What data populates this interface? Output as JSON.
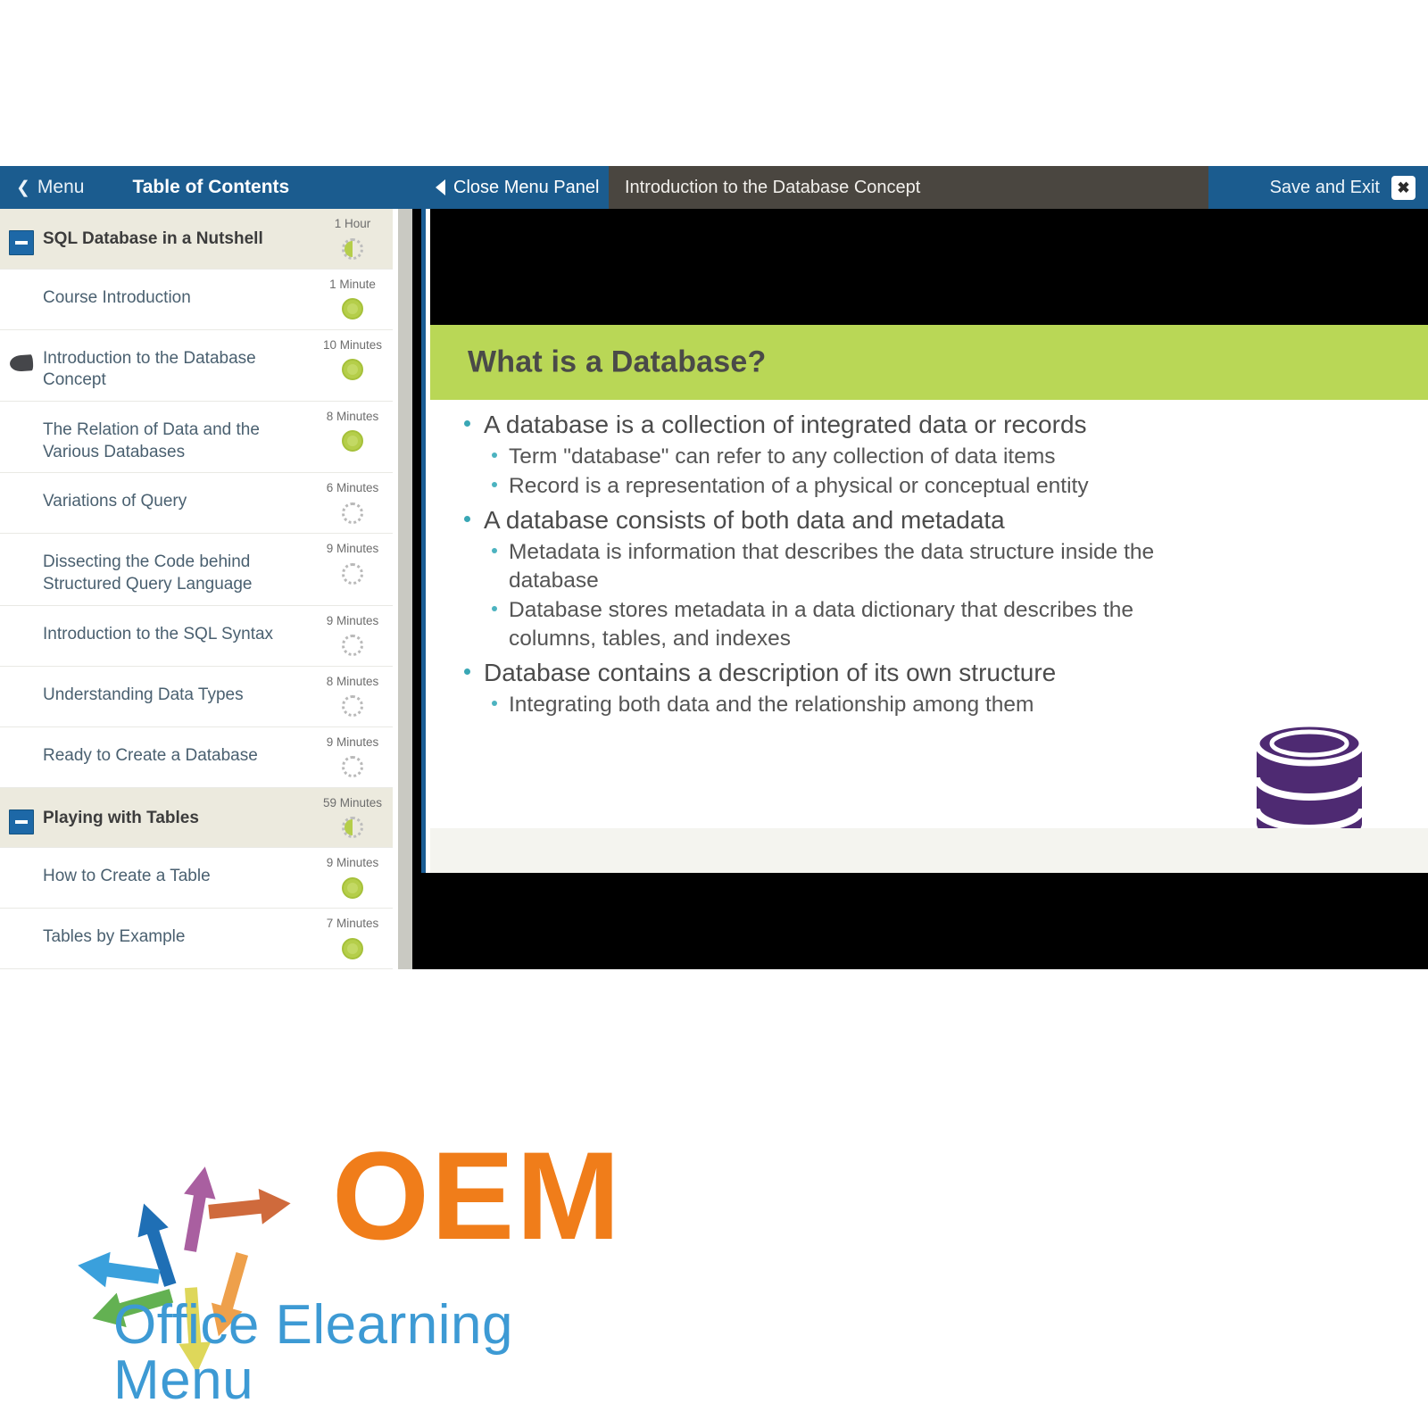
{
  "header": {
    "menu_label": "Menu",
    "toc_label": "Table of Contents",
    "close_panel_label": "Close Menu Panel",
    "current_topic": "Introduction to the Database Concept",
    "save_exit_label": "Save and Exit",
    "close_icon_glyph": "✖",
    "colors": {
      "bar_blue": "#1b5c8f",
      "title_gray": "#4a4640",
      "accent_green": "#b9d756"
    }
  },
  "sidebar": {
    "rows": [
      {
        "type": "section",
        "title": "SQL Database in a Nutshell",
        "duration": "1 Hour",
        "status": "part",
        "current": false
      },
      {
        "type": "item",
        "title": "Course Introduction",
        "duration": "1 Minute",
        "status": "done",
        "current": false
      },
      {
        "type": "item",
        "title": "Introduction to the Database Concept",
        "duration": "10 Minutes",
        "status": "done",
        "current": true
      },
      {
        "type": "item",
        "title": "The Relation of Data and the Various Databases",
        "duration": "8 Minutes",
        "status": "done",
        "current": false
      },
      {
        "type": "item",
        "title": "Variations of Query",
        "duration": "6 Minutes",
        "status": "todo",
        "current": false
      },
      {
        "type": "item",
        "title": "Dissecting the Code behind Structured Query Language",
        "duration": "9 Minutes",
        "status": "todo",
        "current": false
      },
      {
        "type": "item",
        "title": "Introduction to the SQL Syntax",
        "duration": "9 Minutes",
        "status": "todo",
        "current": false
      },
      {
        "type": "item",
        "title": "Understanding Data Types",
        "duration": "8 Minutes",
        "status": "todo",
        "current": false
      },
      {
        "type": "item",
        "title": "Ready to Create a Database",
        "duration": "9 Minutes",
        "status": "todo",
        "current": false
      },
      {
        "type": "section",
        "title": "Playing with Tables",
        "duration": "59 Minutes",
        "status": "part",
        "current": false
      },
      {
        "type": "item",
        "title": "How to Create a Table",
        "duration": "9 Minutes",
        "status": "done",
        "current": false
      },
      {
        "type": "item",
        "title": "Tables by Example",
        "duration": "7 Minutes",
        "status": "done",
        "current": false
      }
    ],
    "scrollbar": {
      "thumb_top_pct": 0,
      "thumb_height_pct": 59
    }
  },
  "slide": {
    "title": "What is a Database?",
    "bullets": [
      {
        "text": "A database is a collection of integrated data or records",
        "children": [
          "Term \"database\" can refer to any collection of data items",
          "Record is a representation of a physical or conceptual entity"
        ]
      },
      {
        "text": "A database consists of both data and metadata",
        "children": [
          "Metadata is information that describes the data structure inside the database",
          "Database stores metadata in a data dictionary that describes the columns, tables, and indexes"
        ]
      },
      {
        "text": "Database contains a description of its own structure",
        "children": [
          "Integrating both data and the relationship among them"
        ]
      }
    ],
    "graphic": {
      "caption": "Database",
      "color": "#4e2a72"
    }
  },
  "logo": {
    "wordmark": "OEM",
    "tagline": "Office Elearning Menu",
    "wordmark_color": "#f07d1a",
    "tagline_color": "#3d9ad4"
  }
}
